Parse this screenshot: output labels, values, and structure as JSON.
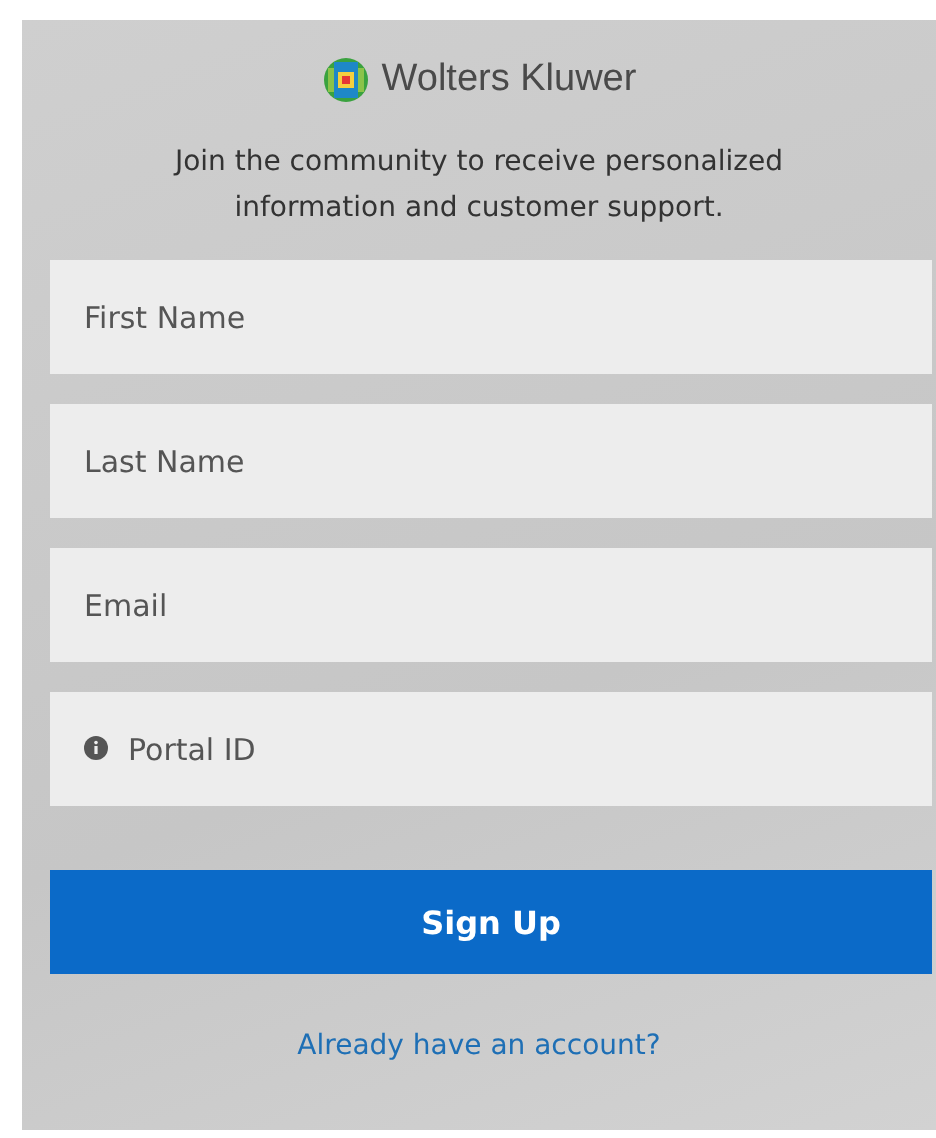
{
  "logo": {
    "name": "Wolters Kluwer"
  },
  "intro": "Join the community to receive personalized information and customer support.",
  "fields": [
    {
      "kind": "plain",
      "placeholder": "First Name"
    },
    {
      "kind": "plain",
      "placeholder": "Last Name"
    },
    {
      "kind": "plain",
      "placeholder": "Email"
    },
    {
      "kind": "info",
      "placeholder": "Portal ID"
    }
  ],
  "submit": "Sign Up",
  "signin_link": "Already have an account?"
}
